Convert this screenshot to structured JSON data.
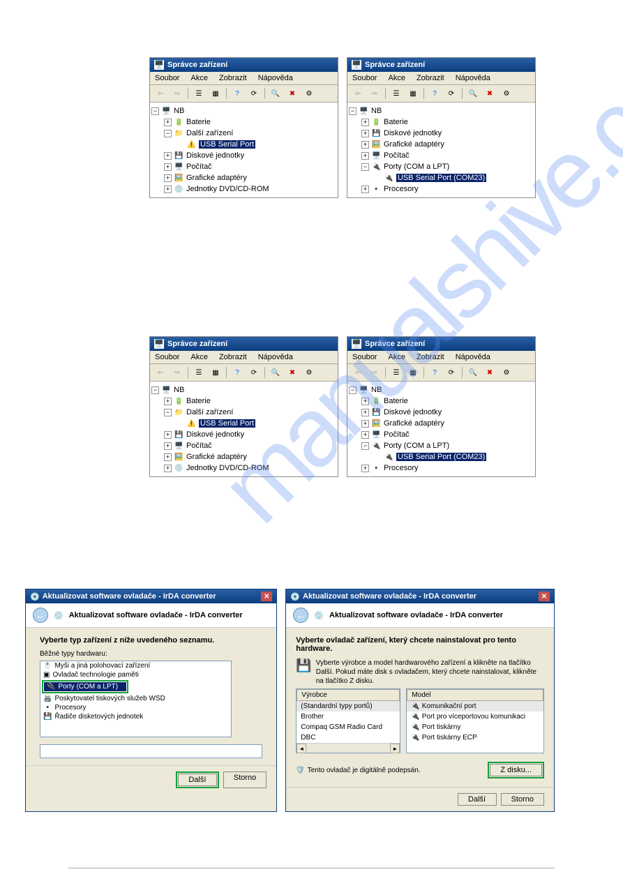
{
  "watermark_text": "manualshive.com",
  "devmgr": {
    "title": "Správce zařízení",
    "menu": {
      "soubor": "Soubor",
      "akce": "Akce",
      "zobrazit": "Zobrazit",
      "napoveda": "Nápověda"
    },
    "root": "NB",
    "left": {
      "items": {
        "baterie": "Baterie",
        "dalsi": "Další zařízení",
        "usb_serial": "USB Serial Port",
        "diskove": "Diskové jednotky",
        "pocitac": "Počítač",
        "graficke": "Grafické adaptéry",
        "dvd": "Jednotky DVD/CD-ROM"
      }
    },
    "right": {
      "items": {
        "baterie": "Baterie",
        "diskove": "Diskové jednotky",
        "graficke": "Grafické adaptéry",
        "pocitac": "Počítač",
        "porty": "Porty (COM a LPT)",
        "usb_serial_com": "USB Serial Port (COM23)",
        "procesory": "Procesory"
      }
    }
  },
  "wizard": {
    "title": "Aktualizovat software ovladače - IrDA converter",
    "header": "Aktualizovat software ovladače - IrDA converter",
    "l": {
      "heading": "Vyberte typ zařízení z níže uvedeného seznamu.",
      "sub": "Běžné typy hardwaru:",
      "items": {
        "mysi": "Myši a jiná polohovací zařízení",
        "ovladace": "Ovladač technologie paměti",
        "porty": "Porty (COM a LPT)",
        "wsd": "Poskytovatel tiskových služeb WSD",
        "procesory": "Procesory",
        "radice": "Řadiče disketových jednotek"
      }
    },
    "r": {
      "heading": "Vyberte ovladač zařízení, který chcete nainstalovat pro tento hardware.",
      "hint": "Vyberte výrobce a model hardwarového zařízení a klikněte na tlačítko Další. Pokud máte disk s ovladačem, který chcete nainstalovat, klikněte na tlačítko Z disku.",
      "col_vyrobce": "Výrobce",
      "col_model": "Model",
      "vyrobce": {
        "std": "(Standardní typy portů)",
        "brother": "Brother",
        "compaq": "Compaq GSM Radio Card",
        "dbc": "DBC"
      },
      "model": {
        "kom": "Komunikační port",
        "vice": "Port pro víceportovou komunikaci",
        "tisk": "Port tiskárny",
        "ecp": "Port tiskárny ECP"
      },
      "signed": "Tento ovladač je digitálně podepsán.",
      "zdisku": "Z disku..."
    },
    "btn": {
      "dalsi": "Další",
      "storno": "Storno"
    }
  }
}
